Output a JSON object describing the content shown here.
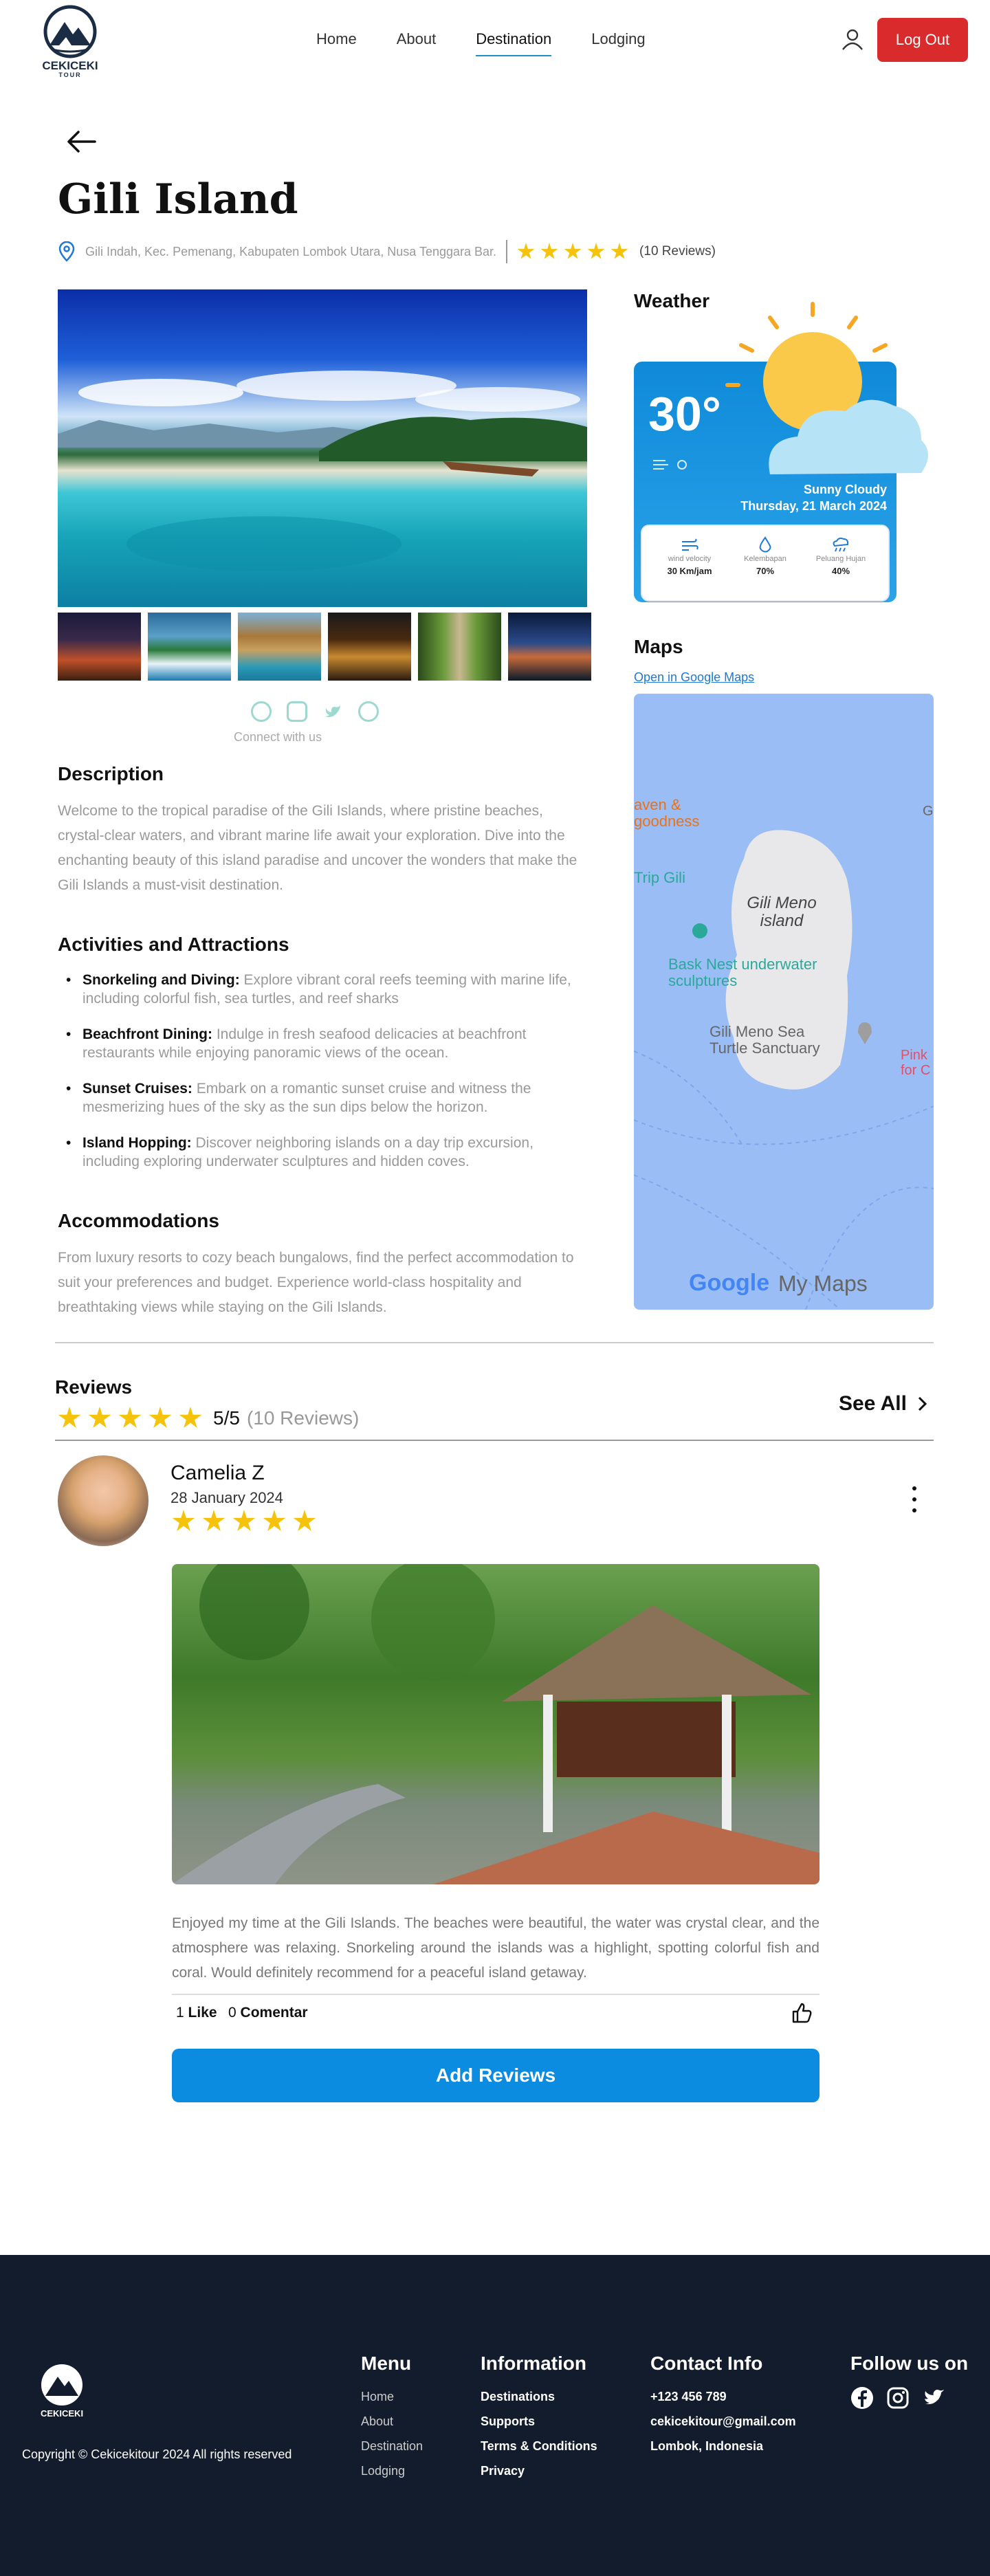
{
  "brand": {
    "name": "CEKICEKI",
    "sub": "TOUR"
  },
  "nav": {
    "items": [
      "Home",
      "About",
      "Destination",
      "Lodging"
    ],
    "active": "Destination"
  },
  "header": {
    "logout_label": "Log Out"
  },
  "page": {
    "title": "Gili Island",
    "location": "Gili Indah, Kec. Pemenang, Kabupaten Lombok Utara, Nusa Tenggara Bar.",
    "rating_stars": 5,
    "reviews_count_label": "(10 Reviews)"
  },
  "social": {
    "connect_label": "Connect with us",
    "icons": [
      "facebook-icon",
      "instagram-icon",
      "twitter-icon",
      "whatsapp-icon"
    ]
  },
  "description": {
    "heading": "Description",
    "text": "Welcome to the tropical paradise of the Gili Islands, where pristine beaches, crystal-clear waters, and vibrant marine life await your exploration. Dive into the enchanting beauty of this island paradise and uncover the wonders that make the Gili Islands a must-visit destination."
  },
  "activities": {
    "heading": "Activities and Attractions",
    "items": [
      {
        "title": "Snorkeling and Diving:",
        "text": " Explore vibrant coral reefs teeming with marine life, including colorful fish, sea turtles, and reef sharks"
      },
      {
        "title": "Beachfront Dining:",
        "text": " Indulge in fresh seafood delicacies at beachfront restaurants while enjoying panoramic views of the ocean."
      },
      {
        "title": "Sunset Cruises:",
        "text": " Embark on a romantic sunset cruise and witness the mesmerizing hues of the sky as the sun dips below the horizon."
      },
      {
        "title": "Island Hopping:",
        "text": " Discover neighboring islands on a day trip excursion, including exploring underwater sculptures and hidden coves."
      }
    ]
  },
  "accommodations": {
    "heading": "Accommodations",
    "text": "From luxury resorts to cozy beach bungalows, find the perfect accommodation to suit your preferences and budget. Experience world-class hospitality and breathtaking views while staying on the Gili Islands."
  },
  "weather": {
    "heading": "Weather",
    "temp": "30°",
    "condition": "Sunny Cloudy",
    "date": "Thursday, 21 March 2024",
    "stats": [
      {
        "label": "wind velocity",
        "value": "30 Km/jam"
      },
      {
        "label": "Kelembapan",
        "value": "70%"
      },
      {
        "label": "Peluang Hujan",
        "value": "40%"
      }
    ]
  },
  "maps": {
    "heading": "Maps",
    "link": "Open in Google Maps",
    "labels": [
      "aven &",
      "goodness",
      "Trip Gili",
      "Gili Meno",
      "island",
      "Bask Nest underwater",
      "sculptures",
      "Gili Meno Sea",
      "Turtle Sanctuary",
      "Pink",
      "for C",
      "G",
      "Google",
      "My Maps"
    ]
  },
  "reviews": {
    "heading": "Reviews",
    "score": "5/5",
    "count": "(10 Reviews)",
    "see_all": "See All",
    "item": {
      "name": "Camelia Z",
      "date": "28 January 2024",
      "stars": 5,
      "text": "Enjoyed my time at the Gili Islands. The beaches were beautiful, the water was crystal clear, and the atmosphere was relaxing. Snorkeling around the islands was a highlight, spotting colorful fish and coral. Would definitely recommend for a peaceful island getaway.",
      "likes": "1",
      "like_label": "Like",
      "comments": "0",
      "comment_label": "Comentar"
    },
    "add_label": "Add Reviews"
  },
  "footer": {
    "copyright": "Copyright © Cekicekitour 2024 All rights reserved",
    "menu": {
      "heading": "Menu",
      "items": [
        "Home",
        "About",
        "Destination",
        "Lodging"
      ]
    },
    "information": {
      "heading": "Information",
      "items": [
        "Destinations",
        "Supports",
        "Terms & Conditions",
        "Privacy"
      ]
    },
    "contact": {
      "heading": "Contact Info",
      "items": [
        "+123 456 789",
        "cekicekitour@gmail.com",
        "Lombok, Indonesia"
      ]
    },
    "follow": {
      "heading": "Follow us on"
    }
  },
  "colors": {
    "accent": "#0c8ce0",
    "danger": "#d92b2b",
    "star": "#f5c30b",
    "footer": "#121c2c"
  }
}
